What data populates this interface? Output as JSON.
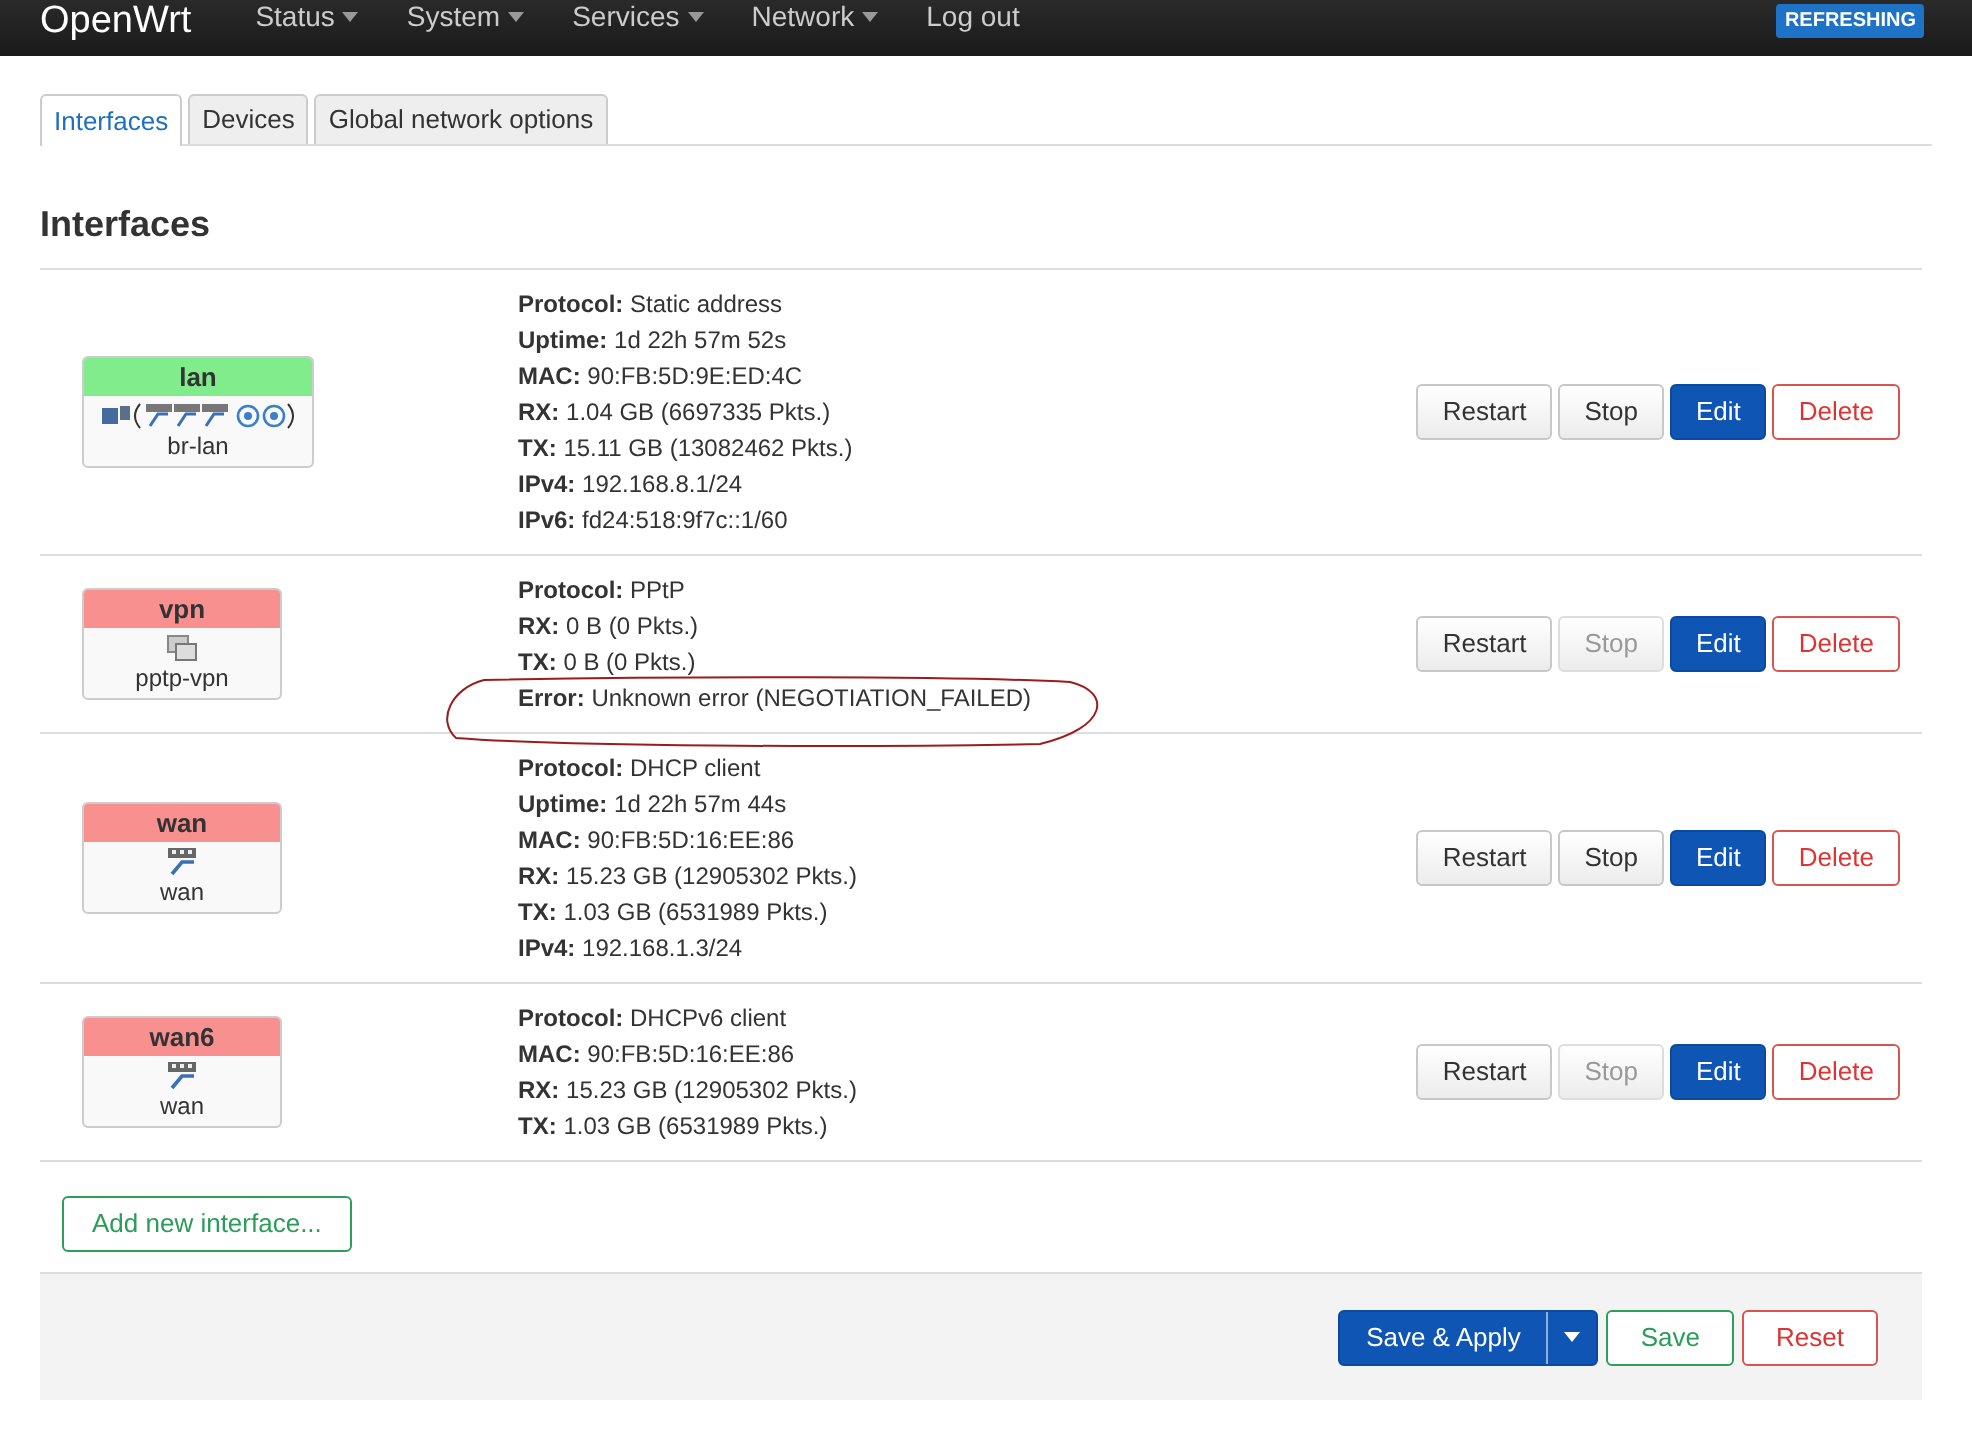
{
  "brand": "OpenWrt",
  "menu": [
    {
      "label": "Status",
      "caret": true
    },
    {
      "label": "System",
      "caret": true
    },
    {
      "label": "Services",
      "caret": true
    },
    {
      "label": "Network",
      "caret": true
    },
    {
      "label": "Log out",
      "caret": false
    }
  ],
  "indicator": "REFRESHING",
  "tabs": [
    {
      "label": "Interfaces",
      "selected": true
    },
    {
      "label": "Devices",
      "selected": false
    },
    {
      "label": "Global network options",
      "selected": false
    }
  ],
  "heading": "Interfaces",
  "interfaces": [
    {
      "name": "lan",
      "up": true,
      "device": "br-lan",
      "kind": "bridge",
      "details": [
        {
          "label": "Protocol:",
          "value": "Static address"
        },
        {
          "label": "Uptime:",
          "value": "1d 22h 57m 52s"
        },
        {
          "label": "MAC:",
          "value": "90:FB:5D:9E:ED:4C"
        },
        {
          "label": "RX:",
          "value": "1.04 GB (6697335 Pkts.)"
        },
        {
          "label": "TX:",
          "value": "15.11 GB (13082462 Pkts.)"
        },
        {
          "label": "IPv4:",
          "value": "192.168.8.1/24"
        },
        {
          "label": "IPv6:",
          "value": "fd24:518:9f7c::1/60"
        }
      ],
      "circled": false,
      "actions": [
        {
          "label": "Restart",
          "kind": "plain",
          "disabled": false
        },
        {
          "label": "Stop",
          "kind": "plain",
          "disabled": false
        },
        {
          "label": "Edit",
          "kind": "primary",
          "disabled": false
        },
        {
          "label": "Delete",
          "kind": "danger",
          "disabled": false
        }
      ]
    },
    {
      "name": "vpn",
      "up": false,
      "device": "pptp-vpn",
      "kind": "tunnel",
      "details": [
        {
          "label": "Protocol:",
          "value": "PPtP"
        },
        {
          "label": "RX:",
          "value": "0 B (0 Pkts.)"
        },
        {
          "label": "TX:",
          "value": "0 B (0 Pkts.)"
        },
        {
          "label": "Error:",
          "value": "Unknown error (NEGOTIATION_FAILED)"
        }
      ],
      "circled": true,
      "actions": [
        {
          "label": "Restart",
          "kind": "plain",
          "disabled": false
        },
        {
          "label": "Stop",
          "kind": "plain",
          "disabled": true
        },
        {
          "label": "Edit",
          "kind": "primary",
          "disabled": false
        },
        {
          "label": "Delete",
          "kind": "danger",
          "disabled": false
        }
      ]
    },
    {
      "name": "wan",
      "up": false,
      "device": "wan",
      "kind": "ethernet",
      "details": [
        {
          "label": "Protocol:",
          "value": "DHCP client"
        },
        {
          "label": "Uptime:",
          "value": "1d 22h 57m 44s"
        },
        {
          "label": "MAC:",
          "value": "90:FB:5D:16:EE:86"
        },
        {
          "label": "RX:",
          "value": "15.23 GB (12905302 Pkts.)"
        },
        {
          "label": "TX:",
          "value": "1.03 GB (6531989 Pkts.)"
        },
        {
          "label": "IPv4:",
          "value": "192.168.1.3/24"
        }
      ],
      "circled": false,
      "actions": [
        {
          "label": "Restart",
          "kind": "plain",
          "disabled": false
        },
        {
          "label": "Stop",
          "kind": "plain",
          "disabled": false
        },
        {
          "label": "Edit",
          "kind": "primary",
          "disabled": false
        },
        {
          "label": "Delete",
          "kind": "danger",
          "disabled": false
        }
      ]
    },
    {
      "name": "wan6",
      "up": false,
      "device": "wan",
      "kind": "ethernet",
      "details": [
        {
          "label": "Protocol:",
          "value": "DHCPv6 client"
        },
        {
          "label": "MAC:",
          "value": "90:FB:5D:16:EE:86"
        },
        {
          "label": "RX:",
          "value": "15.23 GB (12905302 Pkts.)"
        },
        {
          "label": "TX:",
          "value": "1.03 GB (6531989 Pkts.)"
        }
      ],
      "circled": false,
      "actions": [
        {
          "label": "Restart",
          "kind": "plain",
          "disabled": false
        },
        {
          "label": "Stop",
          "kind": "plain",
          "disabled": true
        },
        {
          "label": "Edit",
          "kind": "primary",
          "disabled": false
        },
        {
          "label": "Delete",
          "kind": "danger",
          "disabled": false
        }
      ]
    }
  ],
  "add_button": "Add new interface...",
  "footer_buttons": [
    {
      "label": "Save & Apply",
      "kind": "primary",
      "split": true
    },
    {
      "label": "Save",
      "kind": "positive",
      "split": false
    },
    {
      "label": "Reset",
      "kind": "danger",
      "split": false
    }
  ]
}
